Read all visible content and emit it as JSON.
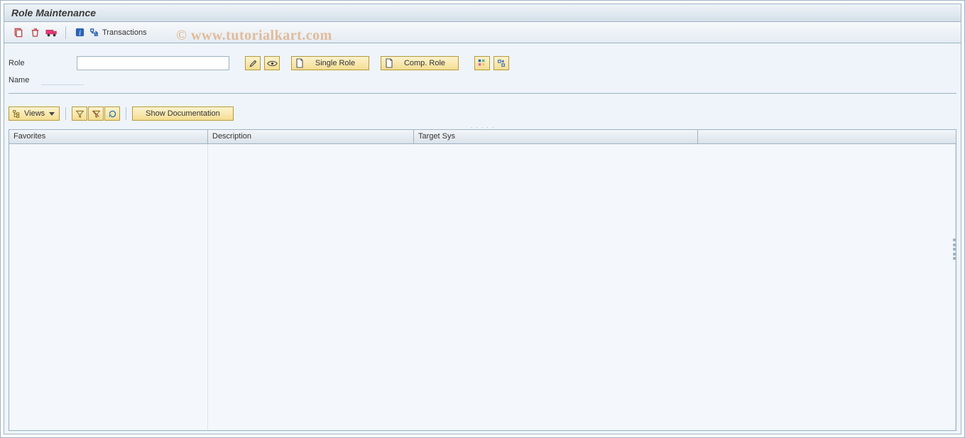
{
  "title": "Role Maintenance",
  "watermark": "© www.tutorialkart.com",
  "appToolbar": {
    "transactions_label": "Transactions"
  },
  "form": {
    "role_label": "Role",
    "role_value": "",
    "name_label": "Name",
    "name_value": "",
    "single_role_btn": "Single Role",
    "comp_role_btn": "Comp. Role"
  },
  "tableToolbar": {
    "views_label": "Views",
    "show_doc_label": "Show Documentation"
  },
  "table": {
    "columns": {
      "favorites": "Favorites",
      "description": "Description",
      "target_sys": "Target Sys"
    },
    "rows": []
  }
}
